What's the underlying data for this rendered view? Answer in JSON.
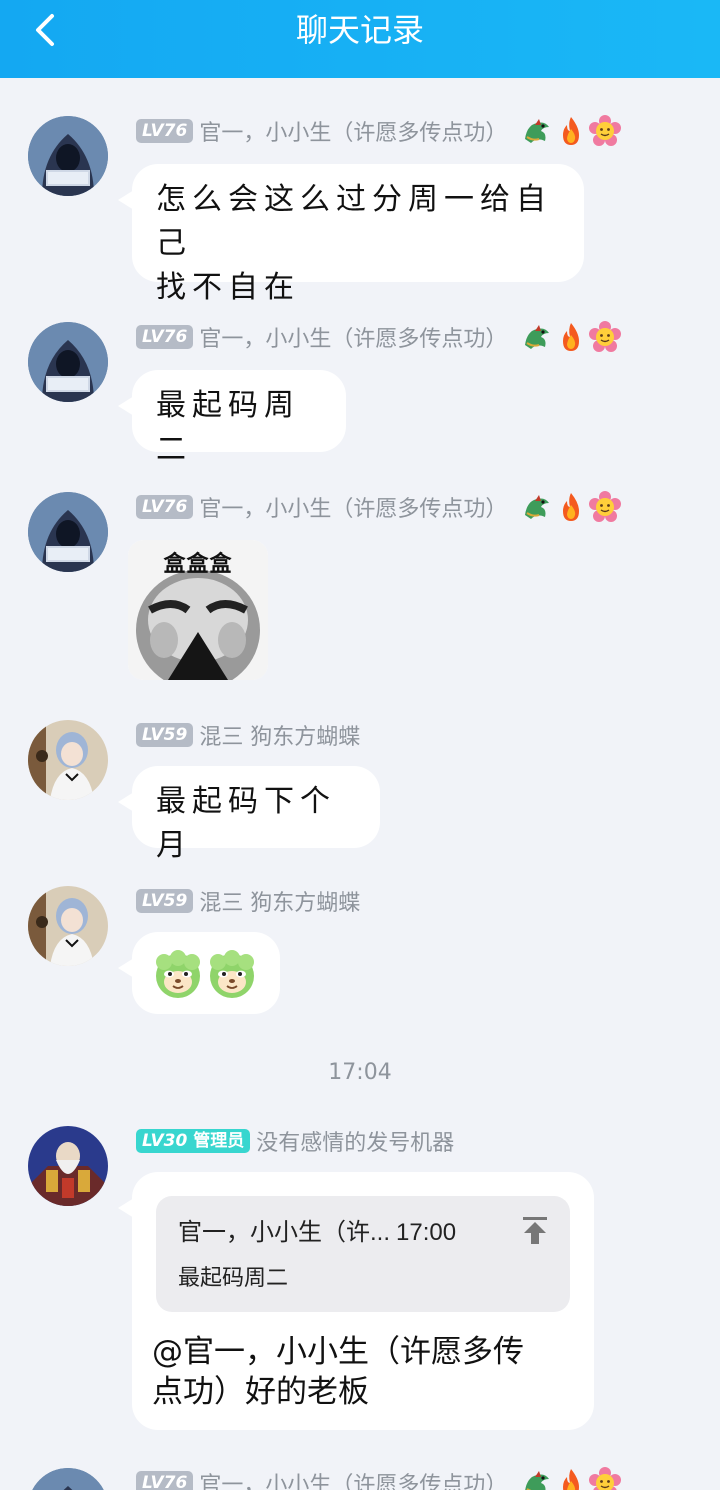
{
  "header": {
    "title": "聊天记录"
  },
  "colors": {
    "header": "#1ab8f6",
    "background": "#f1f3f8",
    "level_badge": "#b5bbc6",
    "admin_badge": "#38d6cf"
  },
  "messages": [
    {
      "level": "LV76",
      "name": "官一，小小生（许愿多传点功）",
      "text": "怎么会这么过分周一给自己找不自在",
      "line1": "怎么会这么过分周一给自己",
      "line2": "找不自在",
      "avatar": "hooded-hacker-avatar",
      "badges": [
        "dragon-icon",
        "fire-icon",
        "flower-icon"
      ]
    },
    {
      "level": "LV76",
      "name": "官一，小小生（许愿多传点功）",
      "text": "最起码周二",
      "avatar": "hooded-hacker-avatar",
      "badges": [
        "dragon-icon",
        "fire-icon",
        "flower-icon"
      ]
    },
    {
      "level": "LV76",
      "name": "官一，小小生（许愿多传点功）",
      "image_caption": "盒盒盒",
      "avatar": "hooded-hacker-avatar",
      "badges": [
        "dragon-icon",
        "fire-icon",
        "flower-icon"
      ]
    },
    {
      "level": "LV59",
      "name": "混三 狗东方蝴蝶",
      "text": "最起码下个月",
      "avatar": "anime-girl-avatar"
    },
    {
      "level": "LV59",
      "name": "混三 狗东方蝴蝶",
      "sticker": "cabbage-dog-emoji",
      "avatar": "anime-girl-avatar"
    }
  ],
  "timestamp": "17:04",
  "admin_message": {
    "level": "LV30",
    "role": "管理员",
    "name": "没有感情的发号机器",
    "avatar": "armored-elder-avatar",
    "quote": {
      "author": "官一，小小生（许...",
      "time": "17:00",
      "text": "最起码周二"
    },
    "text": "@官一，小小生（许愿多传点功）好的老板",
    "line1": "@官一，小小生（许愿多传",
    "line2": "点功）好的老板"
  },
  "last_message": {
    "level": "LV76",
    "name": "官一，小小生（许愿多传点功）",
    "badges": [
      "dragon-icon",
      "fire-icon",
      "flower-icon"
    ]
  }
}
